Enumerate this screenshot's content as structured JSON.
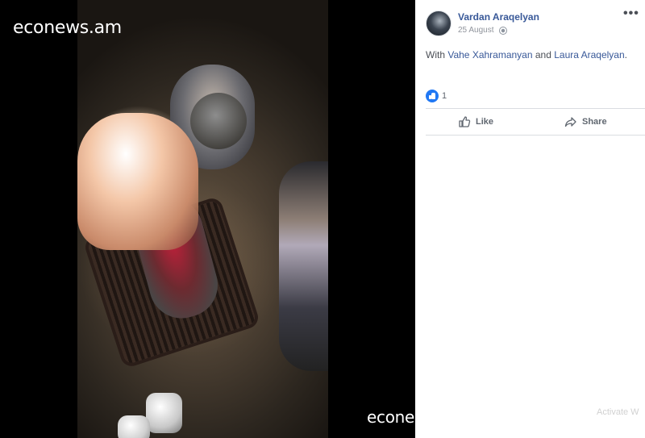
{
  "watermark": {
    "top": "econews.am",
    "bottom": "econews.am"
  },
  "post": {
    "author": "Vardan Araqelyan",
    "date": "25 August",
    "with_prefix": "With",
    "tagged": [
      "Vahe Xahramanyan",
      "Laura Araqelyan"
    ],
    "conjunction": "and",
    "end_punct": ".",
    "like_count": "1"
  },
  "actions": {
    "like_label": "Like",
    "share_label": "Share"
  },
  "system": {
    "activate_text": "Activate W"
  },
  "colors": {
    "link": "#385898",
    "like_blue": "#2078f4",
    "divider": "#dadde1"
  },
  "icons": [
    "globe-icon",
    "more-options-icon",
    "like-reaction-icon",
    "thumbs-up-icon",
    "share-icon"
  ]
}
